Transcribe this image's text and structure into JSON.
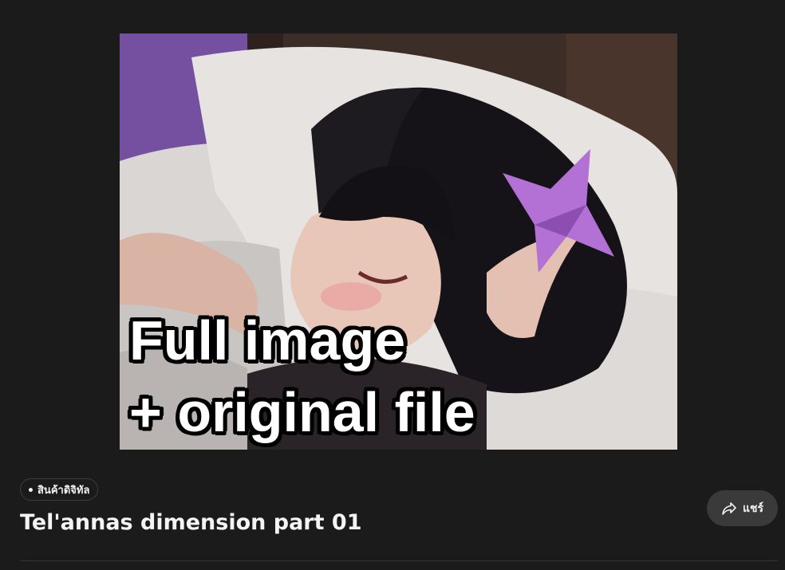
{
  "product": {
    "image_overlay_line_1": "Full image",
    "image_overlay_line_2": "+ original file",
    "tag_label": "สินค้าดิจิทัล",
    "title": "Tel'annas dimension part 01"
  },
  "actions": {
    "share_label": "แชร์",
    "share_icon": "share-arrow-icon"
  },
  "colors": {
    "background": "#1b1b1b",
    "share_button_bg": "#3a3a3a",
    "text": "#f2f2f2"
  }
}
